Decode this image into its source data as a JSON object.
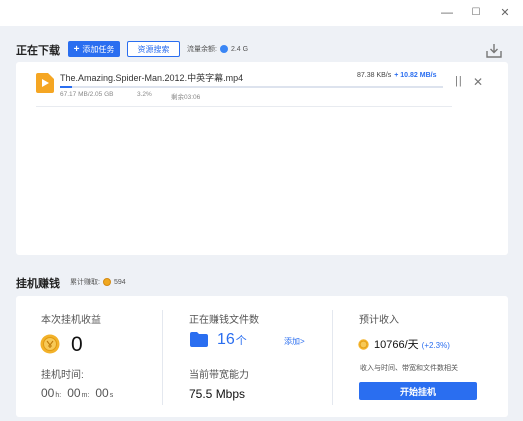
{
  "window": {
    "minimize_glyph": "—",
    "maximize_glyph": "☐",
    "close_glyph": "✕"
  },
  "downloading": {
    "title": "正在下载",
    "add_task_label": "添加任务",
    "resource_search_label": "资源搜索",
    "traffic_label": "流量余额:",
    "traffic_value": "2.4 G"
  },
  "task": {
    "filename": "The.Amazing.Spider-Man.2012.中英字幕.mp4",
    "size_progress": "67.17 MB/2.05 GB",
    "percent_text": "3.2%",
    "progress": 0.032,
    "remaining": "剩余03:06",
    "speed": "87.38 KB/s",
    "speed_boost": "+ 10.82 MB/s",
    "pause_glyph": "| |",
    "close_glyph": "✕"
  },
  "earn": {
    "title": "挂机赚钱",
    "accumulated_label": "累计赚取:",
    "accumulated_value": "594",
    "session_income_label": "本次挂机收益",
    "session_income_value": "0",
    "idle_time_label": "挂机时间:",
    "idle_hours": "00",
    "idle_hours_unit": "h:",
    "idle_minutes": "00",
    "idle_minutes_unit": "m:",
    "idle_seconds": "00",
    "idle_seconds_unit": "s",
    "earning_files_label": "正在赚钱文件数",
    "earning_files_count": "16",
    "earning_files_unit": "个",
    "add_link": "添加>",
    "bandwidth_label": "当前带宽能力",
    "bandwidth_value": "75.5 Mbps",
    "expected_label": "预计收入",
    "expected_value": "10766/天",
    "expected_change": "(+2.3%)",
    "expected_note": "收入与时间、带宽和文件数相关",
    "start_button": "开始挂机"
  },
  "colors": {
    "accent": "#2a6ef0",
    "coin": "#f0a820",
    "file_icon": "#f5a623"
  }
}
